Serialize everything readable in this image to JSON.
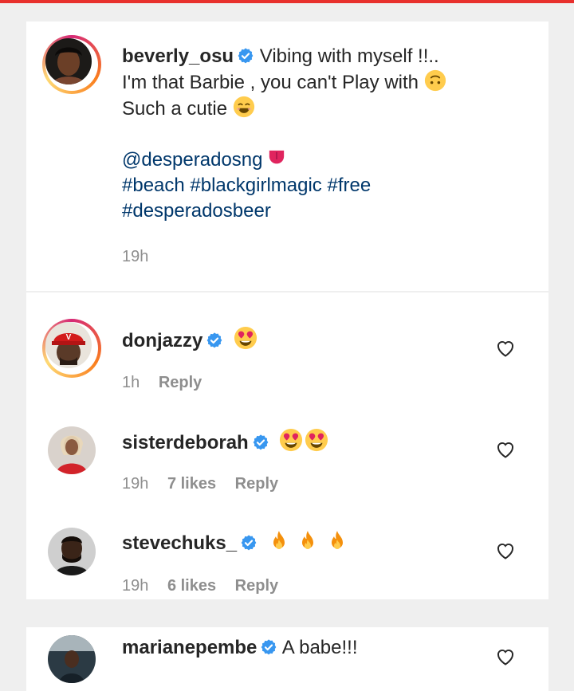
{
  "caption": {
    "username": "beverly_osu",
    "line1": "Vibing with myself !!..",
    "line2": "I'm that Barbie , you can't Play with",
    "line3": "Such a cutie",
    "mention": "@desperadosng",
    "hashtags1": "#beach #blackgirlmagic #free",
    "hashtags2": "#desperadosbeer",
    "time": "19h"
  },
  "comments": [
    {
      "username": "donjazzy",
      "time": "1h",
      "likes": "",
      "reply": "Reply"
    },
    {
      "username": "sisterdeborah",
      "time": "19h",
      "likes": "7 likes",
      "reply": "Reply"
    },
    {
      "username": "stevechuks_",
      "time": "19h",
      "likes": "6 likes",
      "reply": "Reply"
    },
    {
      "username": "marianepembe",
      "text": "A babe!!!"
    }
  ],
  "icons": {
    "verified": "verified-badge-icon",
    "heart": "heart-outline-icon",
    "upside_down": "upside-down-face-emoji",
    "smiling": "smiling-face-emoji",
    "tongue": "tongue-emoji",
    "heart_eyes": "heart-eyes-emoji",
    "fire": "fire-emoji"
  },
  "colors": {
    "accent_bar": "#e8302d",
    "link": "#00376b",
    "verified": "#3897f0",
    "meta": "#8e8e8e"
  }
}
